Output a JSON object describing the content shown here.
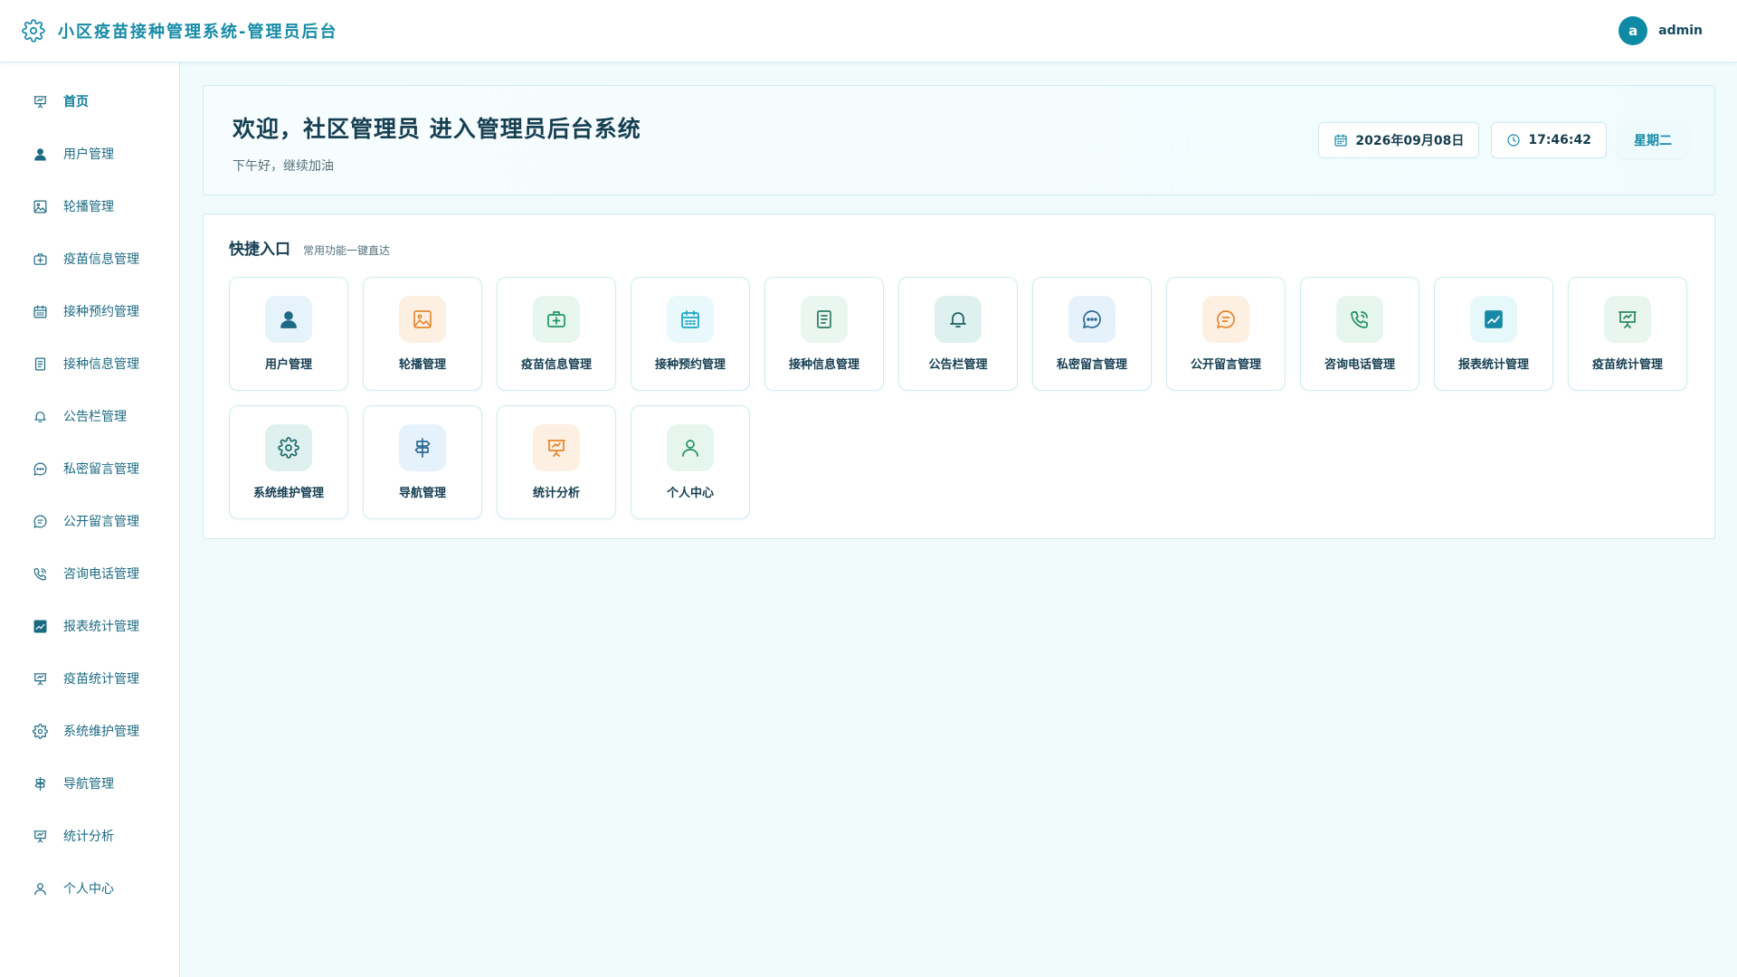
{
  "header": {
    "title": "小区疫苗接种管理系统-管理员后台",
    "logo_icon": "gear-icon",
    "avatar_letter": "a",
    "username": "admin"
  },
  "sidebar": {
    "items": [
      {
        "label": "首页",
        "icon": "presentation-icon",
        "active": true
      },
      {
        "label": "用户管理",
        "icon": "user-solid-icon"
      },
      {
        "label": "轮播管理",
        "icon": "picture-icon"
      },
      {
        "label": "疫苗信息管理",
        "icon": "medkit-icon"
      },
      {
        "label": "接种预约管理",
        "icon": "calendar-icon"
      },
      {
        "label": "接种信息管理",
        "icon": "document-icon"
      },
      {
        "label": "公告栏管理",
        "icon": "bell-icon"
      },
      {
        "label": "私密留言管理",
        "icon": "chat-dots-icon"
      },
      {
        "label": "公开留言管理",
        "icon": "chat-lines-icon"
      },
      {
        "label": "咨询电话管理",
        "icon": "phone-icon"
      },
      {
        "label": "报表统计管理",
        "icon": "chart-solid-icon"
      },
      {
        "label": "疫苗统计管理",
        "icon": "presentation-icon"
      },
      {
        "label": "系统维护管理",
        "icon": "gear-icon"
      },
      {
        "label": "导航管理",
        "icon": "signpost-icon"
      },
      {
        "label": "统计分析",
        "icon": "presentation-icon"
      },
      {
        "label": "个人中心",
        "icon": "user-outline-icon"
      }
    ]
  },
  "welcome": {
    "title": "欢迎，社区管理员 进入管理员后台系统",
    "subtitle": "下午好，继续加油",
    "date": "2026年09月08日",
    "time": "17:46:42",
    "weekday": "星期二"
  },
  "quick": {
    "title": "快捷入口",
    "subtitle": "常用功能一键直达",
    "tiles": [
      {
        "label": "用户管理",
        "icon": "user-solid-icon",
        "bg": "#e6f3fb",
        "color": "#1d6a86"
      },
      {
        "label": "轮播管理",
        "icon": "picture-icon",
        "bg": "#fdf0e3",
        "color": "#e58a33"
      },
      {
        "label": "疫苗信息管理",
        "icon": "medkit-icon",
        "bg": "#e7f6ef",
        "color": "#1f9467"
      },
      {
        "label": "接种预约管理",
        "icon": "calendar-icon",
        "bg": "#e8f8fb",
        "color": "#1aa6c3"
      },
      {
        "label": "接种信息管理",
        "icon": "document-icon",
        "bg": "#eaf7f1",
        "color": "#2d7a63"
      },
      {
        "label": "公告栏管理",
        "icon": "bell-icon",
        "bg": "#def1ef",
        "color": "#1e5f62"
      },
      {
        "label": "私密留言管理",
        "icon": "chat-dots-icon",
        "bg": "#e6f2fb",
        "color": "#2a6a94"
      },
      {
        "label": "公开留言管理",
        "icon": "chat-lines-icon",
        "bg": "#fdf0e3",
        "color": "#e5852c"
      },
      {
        "label": "咨询电话管理",
        "icon": "phone-icon",
        "bg": "#e6f6ee",
        "color": "#1f8f63"
      },
      {
        "label": "报表统计管理",
        "icon": "chart-solid-icon",
        "bg": "#e7f8fb",
        "color": "#178ba6"
      },
      {
        "label": "疫苗统计管理",
        "icon": "presentation-icon",
        "bg": "#e8f6ef",
        "color": "#2a8763"
      },
      {
        "label": "系统维护管理",
        "icon": "gear-icon",
        "bg": "#def1ef",
        "color": "#1e6a6a"
      },
      {
        "label": "导航管理",
        "icon": "signpost-icon",
        "bg": "#e6f2fb",
        "color": "#2a6a94"
      },
      {
        "label": "统计分析",
        "icon": "presentation-icon",
        "bg": "#fdf0e3",
        "color": "#e5852c"
      },
      {
        "label": "个人中心",
        "icon": "user-outline-icon",
        "bg": "#e6f6ee",
        "color": "#1f8f63"
      }
    ]
  },
  "colors": {
    "accent": "#178ba6",
    "background": "#f2fbfc",
    "sidebar_text": "#1c6a82"
  }
}
